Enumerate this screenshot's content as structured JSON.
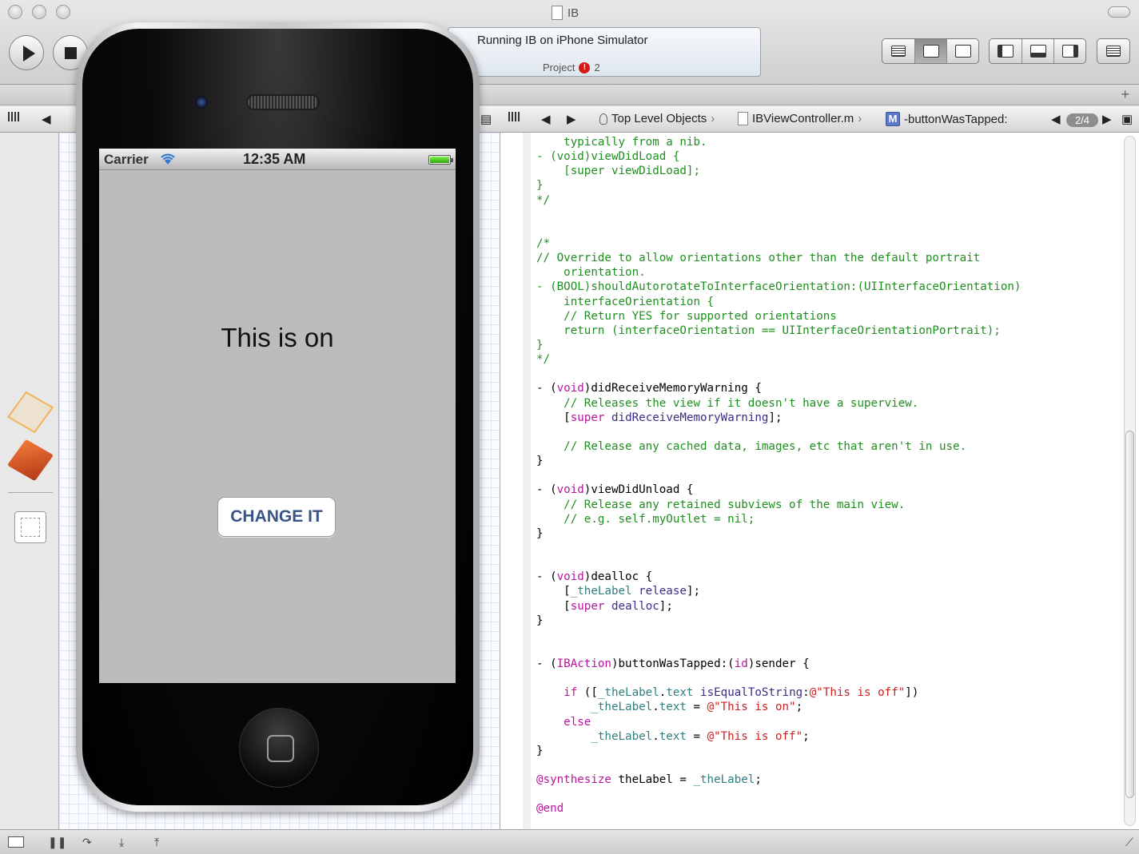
{
  "window": {
    "title": "IB"
  },
  "toolbar": {
    "run_label": "Run",
    "stop_label": "Stop",
    "activity_status": "Running IB on iPhone Simulator",
    "activity_project_label": "Project",
    "issue_count": "2"
  },
  "jumpbar": {
    "crumbs": [
      "Top Level Objects",
      "IBViewController.m",
      "-buttonWasTapped:"
    ],
    "method_icon": "M",
    "counter": "2/4"
  },
  "simulator": {
    "carrier": "Carrier",
    "time": "12:35 AM",
    "label_text": "This is on",
    "button_label": "CHANGE IT"
  },
  "code_lines": [
    "    typically from a nib.",
    "- (void)viewDidLoad {",
    "    [super viewDidLoad];",
    "}",
    "*/",
    "",
    "",
    "/*",
    "// Override to allow orientations other than the default portrait",
    "    orientation.",
    "- (BOOL)shouldAutorotateToInterfaceOrientation:(UIInterfaceOrientation)",
    "    interfaceOrientation {",
    "    // Return YES for supported orientations",
    "    return (interfaceOrientation == UIInterfaceOrientationPortrait);",
    "}",
    "*/",
    "",
    "- (void)didReceiveMemoryWarning {",
    "    // Releases the view if it doesn't have a superview.",
    "    [super didReceiveMemoryWarning];",
    "",
    "    // Release any cached data, images, etc that aren't in use.",
    "}",
    "",
    "- (void)viewDidUnload {",
    "    // Release any retained subviews of the main view.",
    "    // e.g. self.myOutlet = nil;",
    "}",
    "",
    "",
    "- (void)dealloc {",
    "    [_theLabel release];",
    "    [super dealloc];",
    "}",
    "",
    "",
    "- (IBAction)buttonWasTapped:(id)sender {",
    "",
    "    if ([_theLabel.text isEqualToString:@\"This is off\"])",
    "        _theLabel.text = @\"This is on\";",
    "    else",
    "        _theLabel.text = @\"This is off\";",
    "}",
    "",
    "@synthesize theLabel = _theLabel;",
    "",
    "@end"
  ],
  "colors": {
    "comment": "#1f8f1f",
    "keyword": "#b8169a",
    "string": "#cc1f1f",
    "method": "#3e2b86",
    "ivar": "#2f7f7f",
    "button_text": "#385487"
  },
  "icons": {
    "run": "play-icon",
    "stop": "stop-icon",
    "error": "error-badge-icon"
  }
}
